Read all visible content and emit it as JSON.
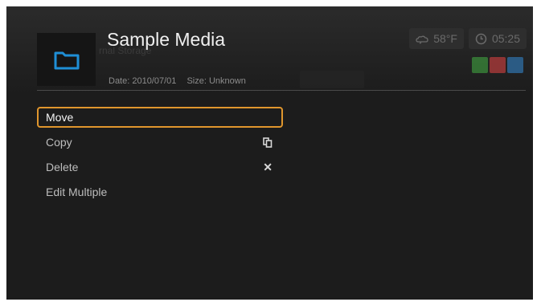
{
  "header": {
    "title": "Sample Media",
    "background_text": "rnal Storage",
    "date_label": "Date: 2010/07/01",
    "size_label": "Size: Unknown",
    "folder_icon": "folder-icon"
  },
  "status": {
    "temperature": "58°F",
    "weather_icon": "weather-icon",
    "time": "05:25",
    "clock_icon": "clock-icon"
  },
  "color_swatches": [
    {
      "color": "#3a8a3a"
    },
    {
      "color": "#b23b3b"
    },
    {
      "color": "#2f6fa6"
    }
  ],
  "menu": {
    "items": [
      {
        "label": "Move",
        "selected": true,
        "icon": ""
      },
      {
        "label": "Copy",
        "selected": false,
        "icon": "copy-icon"
      },
      {
        "label": "Delete",
        "selected": false,
        "icon": "delete-icon"
      },
      {
        "label": "Edit Multiple",
        "selected": false,
        "icon": ""
      }
    ]
  },
  "colors": {
    "accent": "#e0962d",
    "folder_icon": "#1f8fd6",
    "background": "#1c1c1c"
  }
}
